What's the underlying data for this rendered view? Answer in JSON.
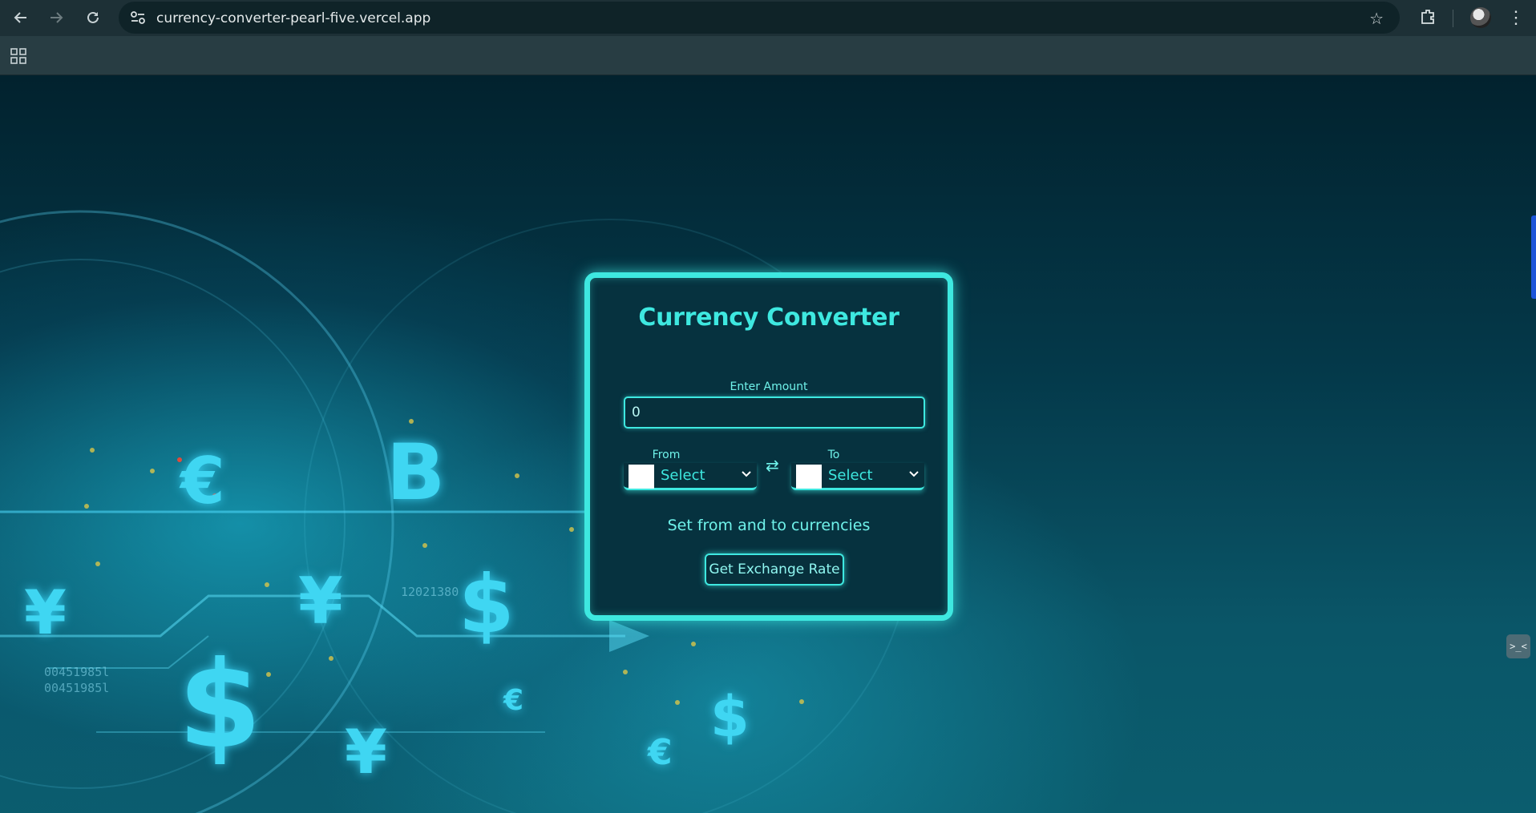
{
  "browser": {
    "url": "currency-converter-pearl-five.vercel.app"
  },
  "background_symbols": {
    "euro": "€",
    "bitcoin": "B",
    "yen": "¥",
    "dollar": "$",
    "digits_a": "12021380",
    "digits_b": "00451985l",
    "digits_c": "00451985l"
  },
  "card": {
    "title": "Currency Converter",
    "amount_label": "Enter Amount",
    "amount_value": "0",
    "from_label": "From",
    "to_label": "To",
    "from_select": "Select",
    "to_select": "Select",
    "swap_symbol": "⇄",
    "status": "Set from and to currencies",
    "button_label": "Get Exchange Rate"
  },
  "widgets": {
    "terminal_label": ">_<"
  },
  "colors": {
    "accent": "#3ee8e0",
    "card_bg": "#06323f",
    "chrome_bg": "#1d3036"
  }
}
